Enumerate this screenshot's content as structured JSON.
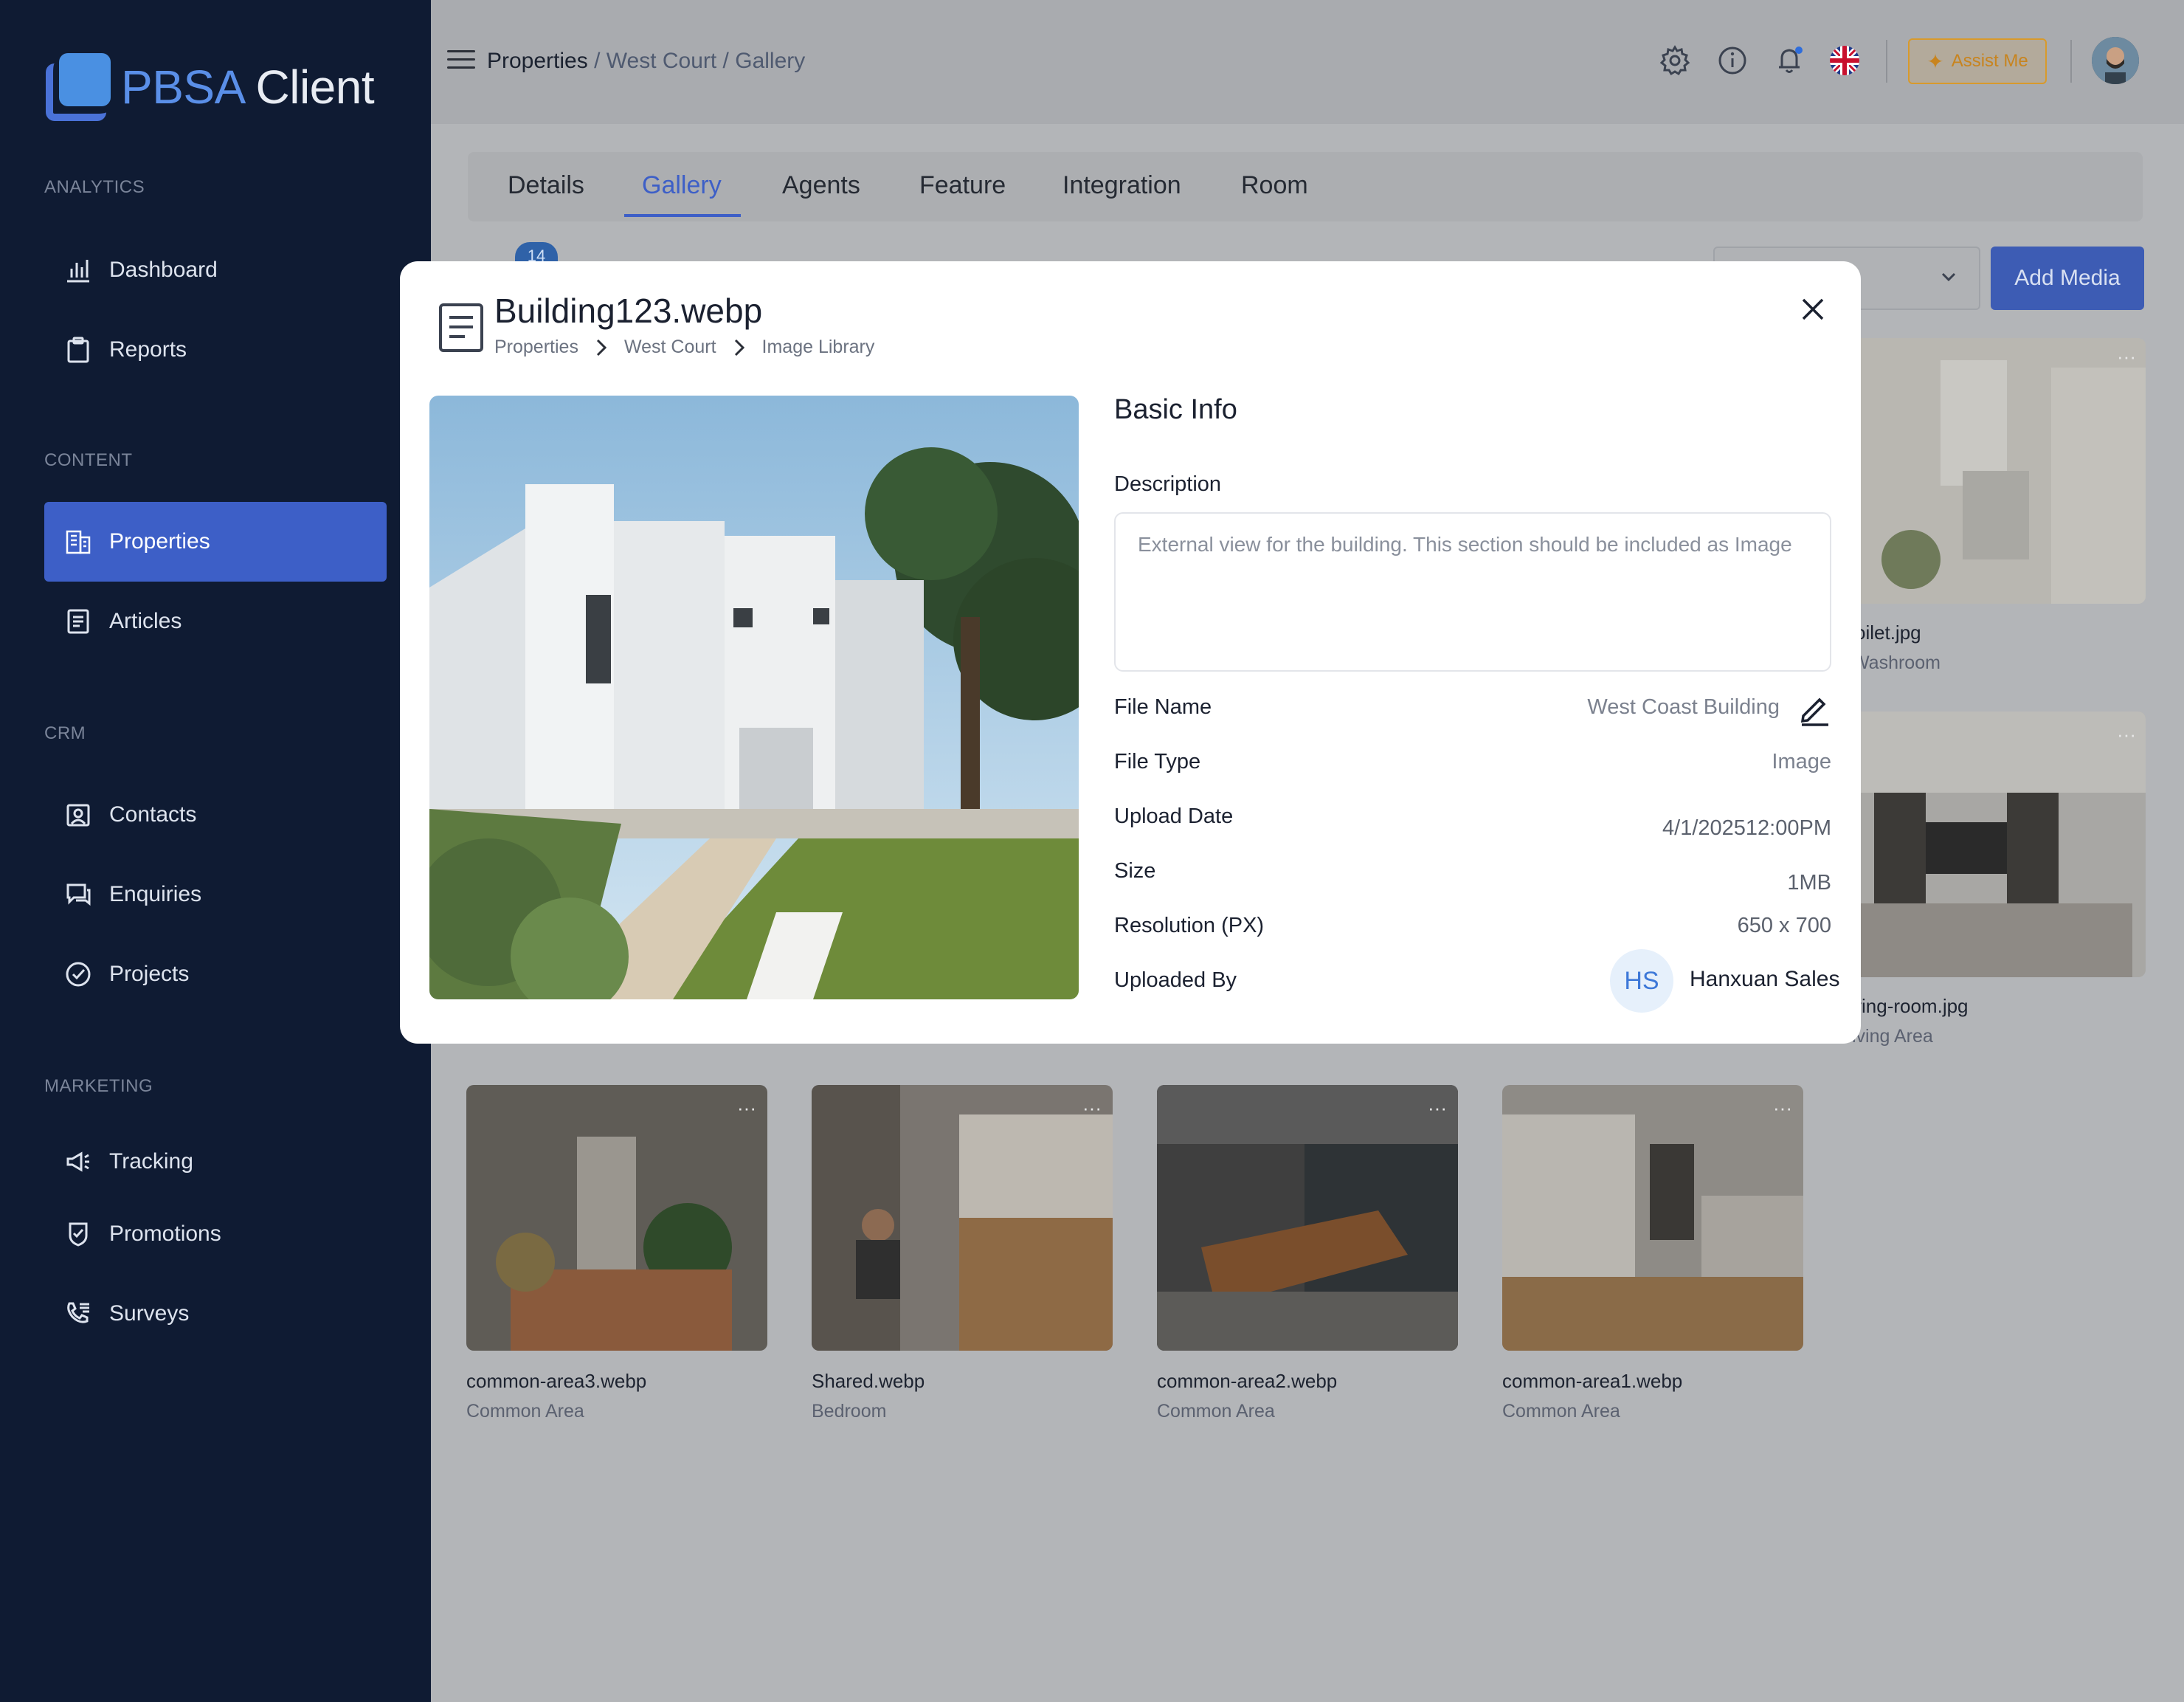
{
  "app": {
    "logo_part1": "PBSA",
    "logo_part2": "Client",
    "accent": "#3d5fc7",
    "sidebar_bg": "#0f1b33"
  },
  "sidebar": {
    "sections": [
      {
        "label": "ANALYTICS",
        "items": [
          {
            "label": "Dashboard",
            "icon": "bar-chart-icon"
          },
          {
            "label": "Reports",
            "icon": "clipboard-icon"
          }
        ]
      },
      {
        "label": "CONTENT",
        "items": [
          {
            "label": "Properties",
            "icon": "building-icon",
            "active": true
          },
          {
            "label": "Articles",
            "icon": "document-icon"
          }
        ]
      },
      {
        "label": "CRM",
        "items": [
          {
            "label": "Contacts",
            "icon": "contact-card-icon"
          },
          {
            "label": "Enquiries",
            "icon": "chat-icon"
          },
          {
            "label": "Projects",
            "icon": "check-circle-icon"
          }
        ]
      },
      {
        "label": "MARKETING",
        "items": [
          {
            "label": "Tracking",
            "icon": "megaphone-icon"
          },
          {
            "label": "Promotions",
            "icon": "shield-check-icon"
          },
          {
            "label": "Surveys",
            "icon": "phone-list-icon"
          }
        ]
      }
    ]
  },
  "header": {
    "breadcrumb": {
      "first": "Properties",
      "rest": " / West Court / Gallery"
    },
    "assist_label": "Assist Me",
    "icons": [
      "gear-icon",
      "info-icon",
      "bell-icon",
      "uk-flag-icon",
      "user-avatar"
    ]
  },
  "tabs": [
    {
      "label": "Details"
    },
    {
      "label": "Gallery",
      "active": true
    },
    {
      "label": "Agents"
    },
    {
      "label": "Feature"
    },
    {
      "label": "Integration"
    },
    {
      "label": "Room"
    }
  ],
  "gallery": {
    "count": "14",
    "add_media_label": "Add Media",
    "cards": [
      {
        "name": "oilet.jpg",
        "category": "Washroom"
      },
      {
        "name": "ving-room.jpg",
        "category": "iving Area"
      },
      {
        "name": "common-area3.webp",
        "category": "Common Area"
      },
      {
        "name": "Shared.webp",
        "category": "Bedroom"
      },
      {
        "name": "common-area2.webp",
        "category": "Common Area"
      },
      {
        "name": "common-area1.webp",
        "category": "Common Area"
      }
    ]
  },
  "modal": {
    "title": "Building123.webp",
    "breadcrumb": [
      "Properties",
      "West Court",
      "Image Library"
    ],
    "section_title": "Basic Info",
    "description_label": "Description",
    "description": "External view for the building. This section should be included as Image",
    "fields": {
      "file_name_label": "File Name",
      "file_name": "West Coast Building",
      "file_type_label": "File Type",
      "file_type": "Image",
      "upload_date_label": "Upload Date",
      "upload_date": "4/1/202512:00PM",
      "size_label": "Size",
      "size": "1MB",
      "resolution_label": "Resolution (PX)",
      "resolution": "650 x 700",
      "uploaded_by_label": "Uploaded By",
      "uploader_initials": "HS",
      "uploader_name": "Hanxuan Sales"
    }
  }
}
